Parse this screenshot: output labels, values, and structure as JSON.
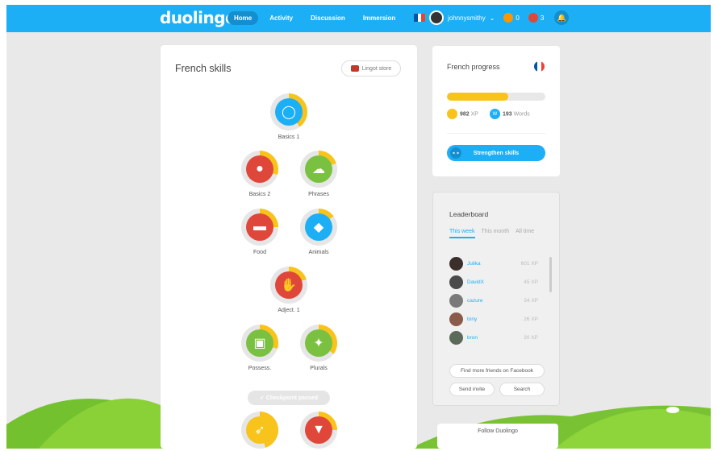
{
  "topbar": {
    "logo": "duolingo",
    "nav": [
      "Home",
      "Activity",
      "Discussion",
      "Immersion"
    ],
    "username": "johnnysmithy",
    "streak": "0",
    "lingots": "3"
  },
  "skills_panel": {
    "title": "French skills",
    "lingot_store": "Lingot store",
    "skills": [
      "Basics 1",
      "Basics 2",
      "Phrases",
      "Food",
      "Animals",
      "Adject. 1",
      "Possess.",
      "Plurals"
    ],
    "checkpoint": "✓ Checkpoint passed"
  },
  "progress_panel": {
    "title": "French progress",
    "xp": "982",
    "xp_unit": "XP",
    "words": "193",
    "words_unit": "Words",
    "progress_fraction": 0.62,
    "strengthen": "Strengthen skills"
  },
  "leaderboard": {
    "title": "Leaderboard",
    "tabs": [
      "This week",
      "This month",
      "All time"
    ],
    "rows": [
      {
        "name": "Julika",
        "xp": "601 XP"
      },
      {
        "name": "DavidX",
        "xp": "45 XP"
      },
      {
        "name": "cazure",
        "xp": "34 XP"
      },
      {
        "name": "tony",
        "xp": "26 XP"
      },
      {
        "name": "bron",
        "xp": "20 XP"
      }
    ],
    "find_friends": "Find more friends on Facebook",
    "send_invite": "Send invite",
    "search": "Search"
  },
  "follow": {
    "label": "Follow Duolingo"
  },
  "colors": {
    "accent": "#1caff6",
    "xp": "#f8c31a"
  }
}
